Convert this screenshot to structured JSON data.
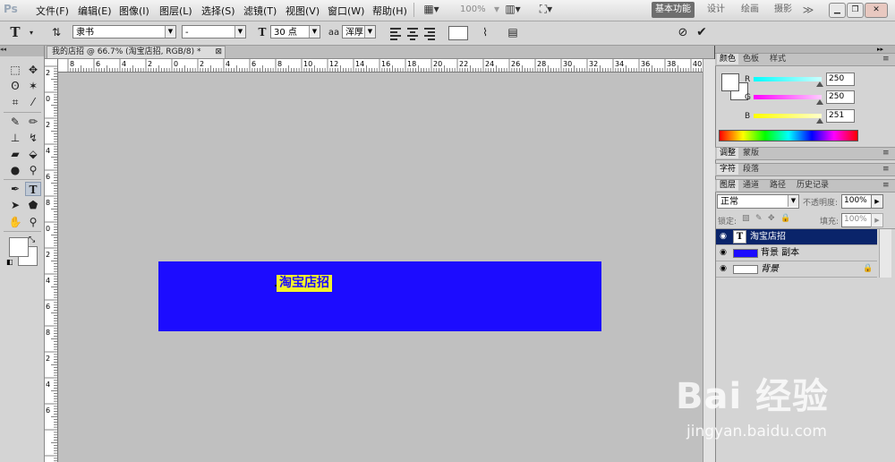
{
  "menubar": {
    "logo": "Ps",
    "items": [
      "文件(F)",
      "编辑(E)",
      "图像(I)",
      "图层(L)",
      "选择(S)",
      "滤镜(T)",
      "视图(V)",
      "窗口(W)",
      "帮助(H)"
    ],
    "zoom": "100%",
    "workspaces": [
      "基本功能",
      "设计",
      "绘画",
      "摄影"
    ],
    "more": "≫"
  },
  "options": {
    "font_family": "隶书",
    "font_style": "-",
    "font_size": "30 点",
    "antialias": "浑厚"
  },
  "document": {
    "tab_title": "我的店招 @ 66.7% (淘宝店招, RGB/8) *",
    "ruler_top": [
      "8",
      "6",
      "4",
      "2",
      "0",
      "2",
      "4",
      "6",
      "8",
      "10",
      "12",
      "14",
      "16",
      "18",
      "20",
      "22",
      "24",
      "26",
      "28",
      "30",
      "32",
      "34",
      "36",
      "38",
      "40"
    ],
    "ruler_left": [
      "2",
      "0",
      "2",
      "4",
      "6",
      "8",
      "0",
      "2",
      "4",
      "6",
      "8",
      "2",
      "4",
      "6"
    ],
    "banner_text": "淘宝店招",
    "banner_color": "#1c0cff",
    "text_highlight_color": "#f3f32a"
  },
  "color_panel": {
    "tabs": [
      "颜色",
      "色板",
      "样式"
    ],
    "r_label": "R",
    "g_label": "G",
    "b_label": "B",
    "r": "250",
    "g": "250",
    "b": "251"
  },
  "adjust_panel": {
    "tabs": [
      "调整",
      "蒙版"
    ]
  },
  "char_panel": {
    "tabs": [
      "字符",
      "段落"
    ]
  },
  "layers_panel": {
    "tabs": [
      "图层",
      "通道",
      "路径",
      "历史记录"
    ],
    "blend_mode": "正常",
    "opacity_label": "不透明度:",
    "opacity": "100%",
    "lock_label": "锁定:",
    "fill_label": "填充:",
    "fill": "100%",
    "layers": [
      {
        "name": "淘宝店招",
        "type": "text"
      },
      {
        "name": "背景 副本",
        "type": "image"
      },
      {
        "name": "背景",
        "type": "image"
      }
    ]
  },
  "watermark": {
    "brand": "Bai 经验",
    "url": "jingyan.baidu.com"
  }
}
